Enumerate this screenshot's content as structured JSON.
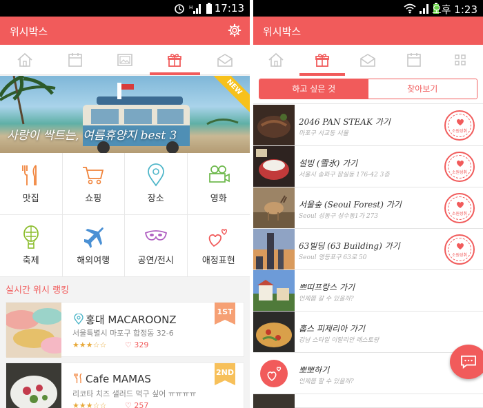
{
  "left": {
    "status": {
      "time": "17:13"
    },
    "appbar": {
      "title": "위시박스",
      "settings_icon": "gear-icon"
    },
    "tabs": [
      {
        "icon": "home-icon",
        "active": false
      },
      {
        "icon": "calendar-icon",
        "active": false
      },
      {
        "icon": "gallery-icon",
        "active": false
      },
      {
        "icon": "giftbox-icon",
        "active": true
      },
      {
        "icon": "mail-icon",
        "active": false
      }
    ],
    "banner": {
      "caption": "사랑이 싹트는, 여름휴양지 best 3",
      "ribbon": "NEW"
    },
    "categories": [
      {
        "label": "맛집",
        "icon": "fork-knife-icon"
      },
      {
        "label": "쇼핑",
        "icon": "cart-icon"
      },
      {
        "label": "장소",
        "icon": "map-pin-icon"
      },
      {
        "label": "영화",
        "icon": "film-camera-icon"
      },
      {
        "label": "축제",
        "icon": "balloon-icon"
      },
      {
        "label": "해외여행",
        "icon": "airplane-icon"
      },
      {
        "label": "공연/전시",
        "icon": "mask-icon"
      },
      {
        "label": "애정표현",
        "icon": "hearts-icon"
      }
    ],
    "ranking_title": "실시간 위시 랭킹",
    "ranking": [
      {
        "name": "홍대 MACAROONZ",
        "address": "서울특별시 마포구 합정동 32-6",
        "stars": "★★★☆☆",
        "likes": "329",
        "rank": "1ST"
      },
      {
        "name": "Cafe MAMAS",
        "address": "리코타 치즈 샐러드 먹구 싶어 ㅠㅠㅠㅠ",
        "stars": "★★★☆☆",
        "likes": "257",
        "rank": "2ND"
      }
    ]
  },
  "right": {
    "status": {
      "time": "오후 1:23"
    },
    "appbar": {
      "title": "위시박스"
    },
    "tabs": [
      {
        "icon": "home-icon",
        "active": false
      },
      {
        "icon": "giftbox-icon",
        "active": true
      },
      {
        "icon": "mail-icon",
        "active": false
      },
      {
        "icon": "calendar-icon",
        "active": false
      },
      {
        "icon": "grid-icon",
        "active": false
      }
    ],
    "segment": {
      "left": "하고 싶은 것",
      "right": "찾아보기"
    },
    "items": [
      {
        "title": "2046 PAN STEAK 가기",
        "sub": "마포구 서교동 서울",
        "stamped": true,
        "stamp_text": "소원성취"
      },
      {
        "title": "설빙 (雪氷) 가기",
        "sub": "서울시 송파구 잠실동 176-42 3층",
        "stamped": true,
        "stamp_text": "소원성취"
      },
      {
        "title": "서울숲 (Seoul Forest) 가기",
        "sub": "Seoul 성동구 성수동1가 273",
        "stamped": true,
        "stamp_text": "소원성취"
      },
      {
        "title": "63빌딩 (63 Building) 가기",
        "sub": "Seoul 영등포구 63로 50",
        "stamped": true,
        "stamp_text": "소원성취"
      },
      {
        "title": "쁘띠프랑스 가기",
        "sub": "언제쯤 갈 수 있을까?",
        "stamped": false
      },
      {
        "title": "홉스 피제리아 가기",
        "sub": "강남 스타일 이탈리안 레스토랑",
        "stamped": false
      },
      {
        "title": "뽀뽀하기",
        "sub": "언제쯤 할 수 있을까?",
        "stamped": false
      }
    ],
    "fab_icon": "chat-bubble-icon"
  },
  "colors": {
    "accent": "#f15b5b",
    "rank1": "#f6a074",
    "rank2": "#f7c05a",
    "stars": "#e8a93a"
  }
}
